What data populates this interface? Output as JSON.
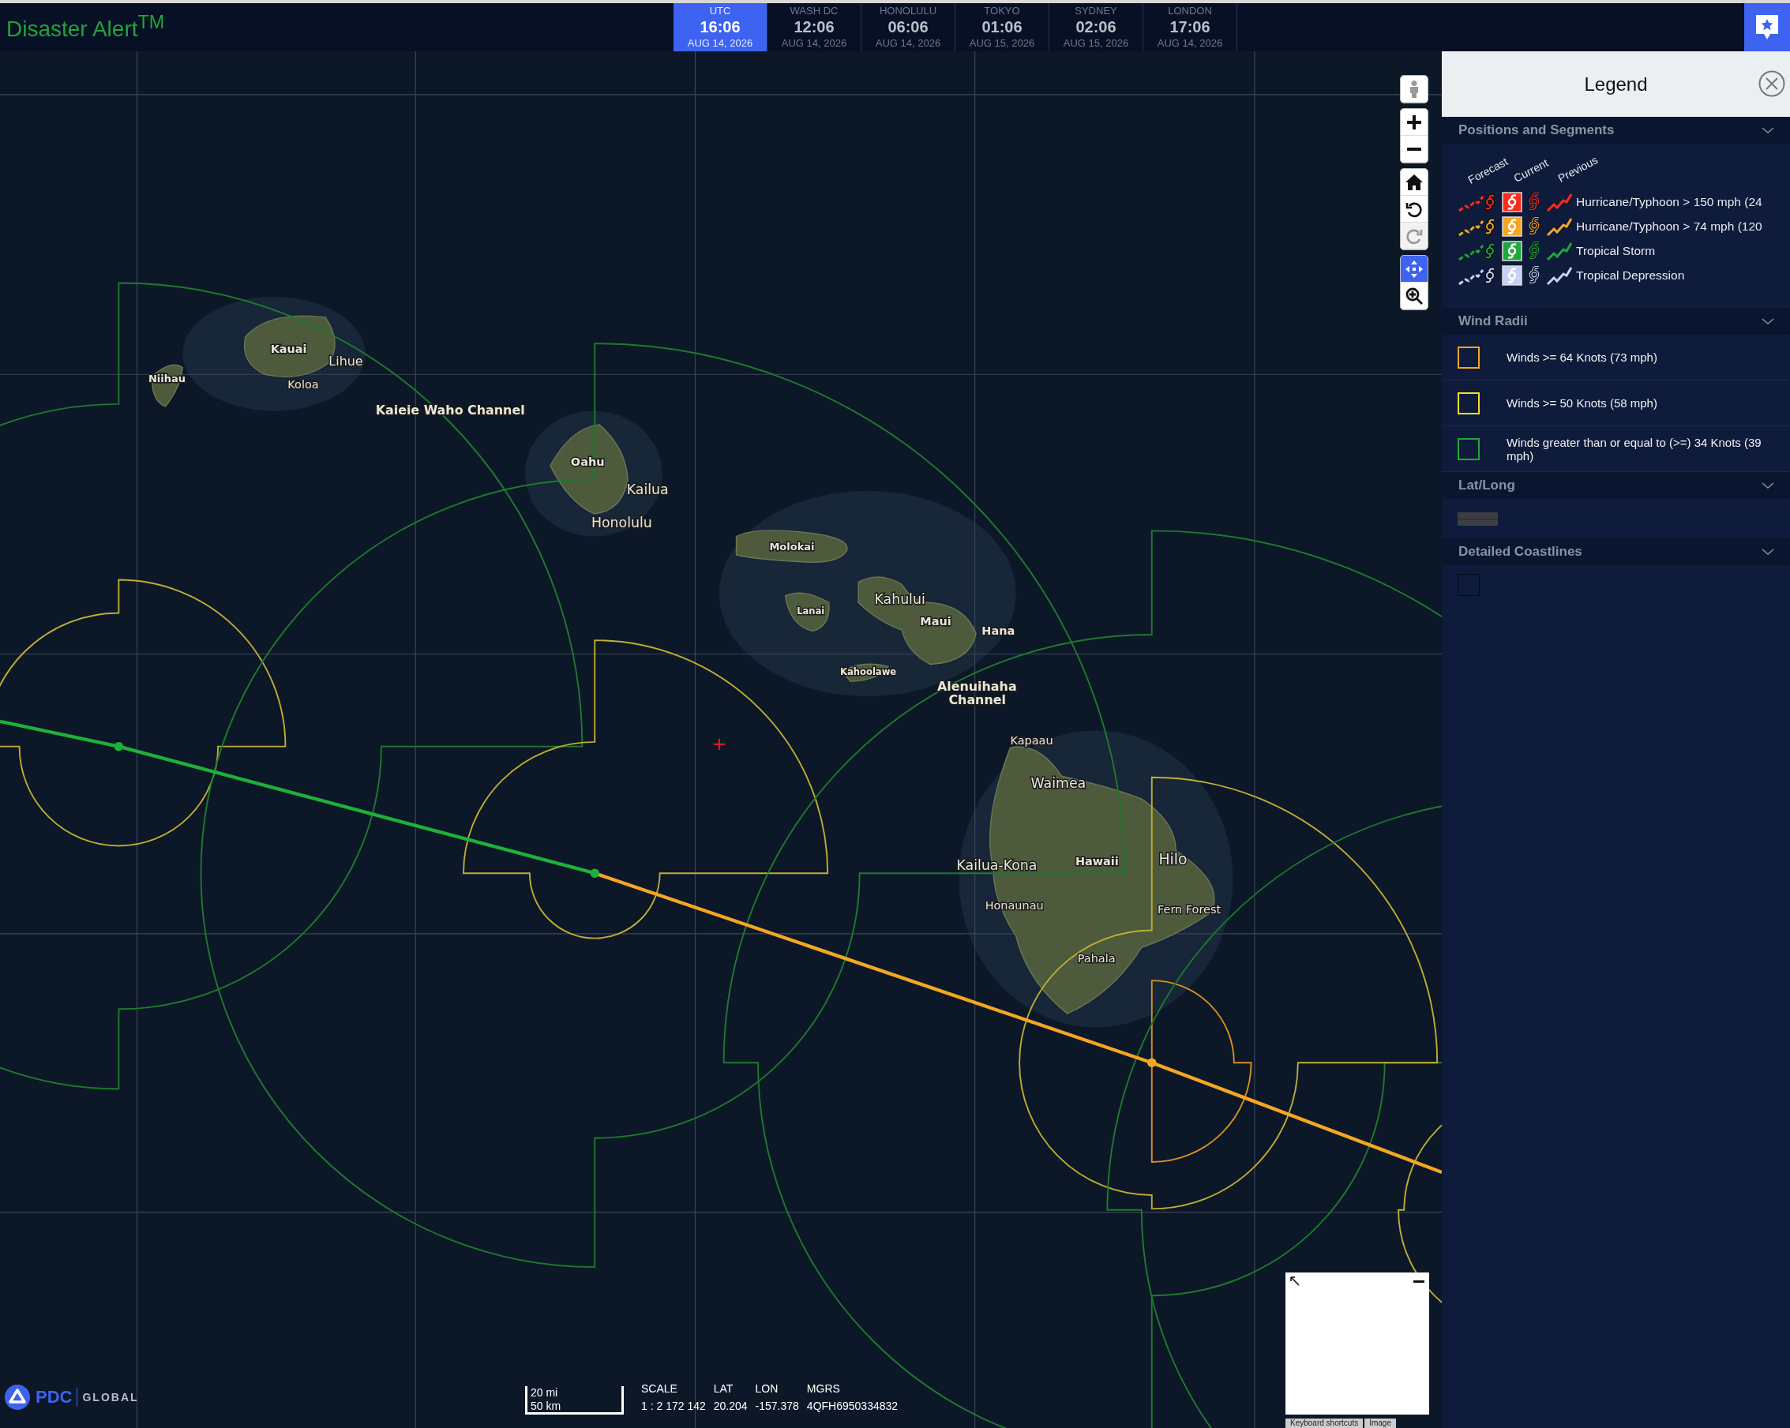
{
  "header": {
    "title": "Disaster Alert$^{TM}$"
  },
  "time_zones": [
    {
      "label": "UTC",
      "time": "16:06",
      "date": "AUG 14, 2026",
      "selected": true
    },
    {
      "label": "WASH DC",
      "time": "12:06",
      "date": "AUG 14, 2026",
      "selected": false
    },
    {
      "label": "HONOLULU",
      "time": "06:06",
      "date": "AUG 14, 2026",
      "selected": false
    },
    {
      "label": "TOKYO",
      "time": "01:06",
      "date": "AUG 15, 2026",
      "selected": false
    },
    {
      "label": "SYDNEY",
      "time": "02:06",
      "date": "AUG 15, 2026",
      "selected": false
    },
    {
      "label": "LONDON",
      "time": "17:06",
      "date": "AUG 14, 2026",
      "selected": false
    }
  ],
  "map": {
    "place_labels": [
      "Kauai",
      "Lihue",
      "Niihau",
      "Koloa",
      "Kaieie Waho Channel",
      "Oahu",
      "Kailua",
      "Honolulu",
      "Molokai",
      "Lanai",
      "Kahului",
      "Maui",
      "Hana",
      "Kahoolawe",
      "Alenuihaha Channel",
      "Kapaau",
      "Waimea",
      "Kailua-Kona",
      "Hawaii",
      "Hilo",
      "Honaunau",
      "Fern Forest",
      "Pahala"
    ],
    "tool_groups": [
      {
        "tools": [
          {
            "kind": "person",
            "selected": false,
            "disabled": false
          }
        ]
      },
      {
        "tools": [
          {
            "kind": "zoom-in",
            "selected": false,
            "disabled": false
          },
          {
            "kind": "zoom-out",
            "selected": false,
            "disabled": false
          }
        ]
      },
      {
        "tools": [
          {
            "kind": "home",
            "selected": false,
            "disabled": false
          },
          {
            "kind": "rotate-left",
            "selected": false,
            "disabled": false
          },
          {
            "kind": "rotate-right",
            "selected": false,
            "disabled": true
          }
        ]
      },
      {
        "tools": [
          {
            "kind": "pan",
            "selected": true,
            "disabled": false
          },
          {
            "kind": "zoom-box",
            "selected": false,
            "disabled": false
          }
        ]
      }
    ],
    "logo": {
      "name": "PDC",
      "tagline": "GLOBAL"
    },
    "scale": {
      "miles": "20 mi",
      "km": "50 km"
    },
    "readouts": [
      {
        "label": "SCALE",
        "value": "1 : 2 172 142"
      },
      {
        "label": "LAT",
        "value": "20.204"
      },
      {
        "label": "LON",
        "value": "-157.378"
      },
      {
        "label": "MGRS",
        "value": "4QFH6950334832"
      }
    ],
    "attribution": [
      "Keyboard shortcuts",
      "Image"
    ]
  },
  "legend": {
    "title": "Legend",
    "sections": [
      {
        "title": "Positions and Segments",
        "columns": [
          "Forecast",
          "Current",
          "Previous"
        ],
        "rows": [
          {
            "kind": "storm",
            "label": "Hurricane/Typhoon > 150 mph (24",
            "color": "#ff2a1a"
          },
          {
            "kind": "storm",
            "label": "Hurricane/Typhoon > 74 mph (120",
            "color": "#f5a623"
          },
          {
            "kind": "storm",
            "label": "Tropical Storm",
            "color": "#1fa83a"
          },
          {
            "kind": "storm",
            "label": "Tropical Depression",
            "color": "#c8d0f5"
          }
        ]
      },
      {
        "title": "Wind Radii",
        "rows": [
          {
            "kind": "swatch",
            "label": "Winds >= 64 Knots (73 mph)",
            "color": "#f5a623"
          },
          {
            "kind": "swatch",
            "label": "Winds >= 50 Knots (58 mph)",
            "color": "#f0e020"
          },
          {
            "kind": "swatch",
            "label": "Winds greater than or equal to (>=) 34 Knots (39 mph)",
            "color": "#1fa83a"
          }
        ]
      },
      {
        "title": "Lat/Long",
        "rows": [
          {
            "kind": "gridline"
          }
        ]
      },
      {
        "title": "Detailed Coastlines",
        "rows": [
          {
            "kind": "outline"
          }
        ]
      }
    ]
  }
}
